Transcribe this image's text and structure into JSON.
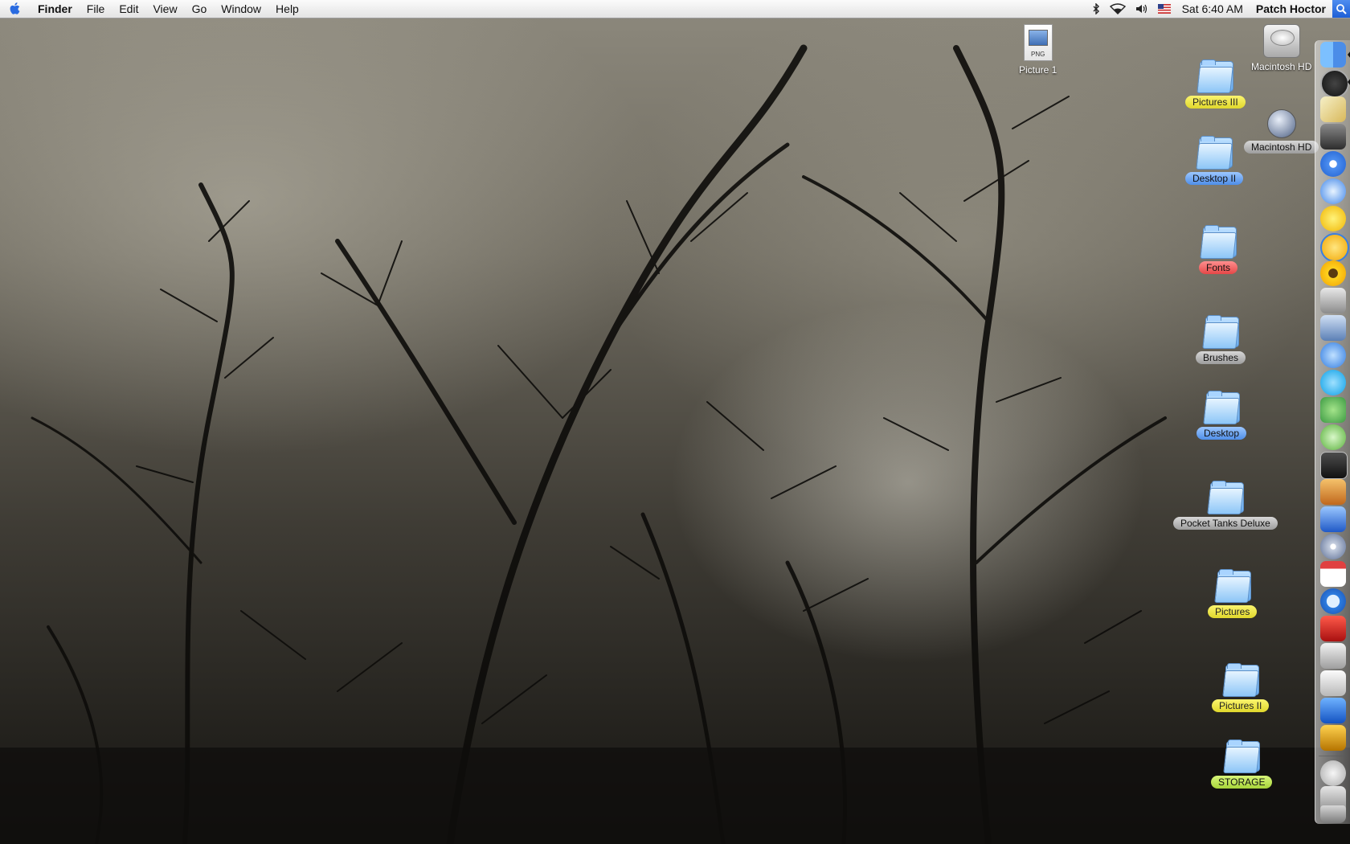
{
  "menubar": {
    "apple_icon": "apple-logo-icon",
    "app_name": "Finder",
    "menus": [
      "File",
      "Edit",
      "View",
      "Go",
      "Window",
      "Help"
    ],
    "status_icons": [
      "bluetooth-icon",
      "wifi-icon",
      "volume-icon",
      "us-flag-input-icon"
    ],
    "clock": "Sat 6:40 AM",
    "user": "Patch Hoctor",
    "spotlight_icon": "spotlight-search-icon"
  },
  "desktop": {
    "items": [
      {
        "name": "Picture 1",
        "kind": "png-file",
        "label_color": "none",
        "badge": "PNG"
      },
      {
        "name": "Macintosh HD",
        "kind": "hard-drive",
        "label_color": "none"
      },
      {
        "name": "Pictures III",
        "kind": "folder",
        "label_color": "yellow"
      },
      {
        "name": "Macintosh HD",
        "kind": "network-volume",
        "label_color": "gray"
      },
      {
        "name": "Desktop II",
        "kind": "folder",
        "label_color": "blue"
      },
      {
        "name": "Fonts",
        "kind": "folder",
        "label_color": "red"
      },
      {
        "name": "Brushes",
        "kind": "folder",
        "label_color": "gray"
      },
      {
        "name": "Desktop",
        "kind": "folder",
        "label_color": "blue"
      },
      {
        "name": "Pocket Tanks Deluxe",
        "kind": "folder",
        "label_color": "gray"
      },
      {
        "name": "Pictures",
        "kind": "folder",
        "label_color": "yellow"
      },
      {
        "name": "Pictures II",
        "kind": "folder",
        "label_color": "yellow"
      },
      {
        "name": "STORAGE",
        "kind": "folder",
        "label_color": "green"
      }
    ]
  },
  "dock": {
    "position": "right",
    "apps": [
      "finder-icon",
      "dashboard-icon",
      "pencil-app-icon",
      "graduation-cap-icon",
      "target-icon",
      "safari-icon",
      "chat-smiley-icon",
      "messenger-icon",
      "sunflower-icon",
      "pen-nib-icon",
      "bird-preview-icon",
      "video-chat-icon",
      "skype-icon",
      "people-icon",
      "itunes-icon",
      "activity-monitor-icon",
      "iphoto-icon",
      "imovie-icon",
      "dvd-player-icon",
      "ical-icon",
      "quicktime-icon",
      "red-book-icon",
      "system-preferences-icon",
      "textedit-icon",
      "wacom-icon",
      "car-game-icon"
    ],
    "running_indicators": [
      "finder-icon",
      "dashboard-icon"
    ],
    "stacks": [
      "mail-at-icon",
      "downloads-stack-icon",
      "trash-icon"
    ]
  },
  "colors": {
    "menubar_bg": "#ececec",
    "label_yellow": "#eee84a",
    "label_blue": "#6ea5f0",
    "label_red": "#f06060",
    "label_gray": "#b5b5b5",
    "label_green": "#bde25a"
  }
}
